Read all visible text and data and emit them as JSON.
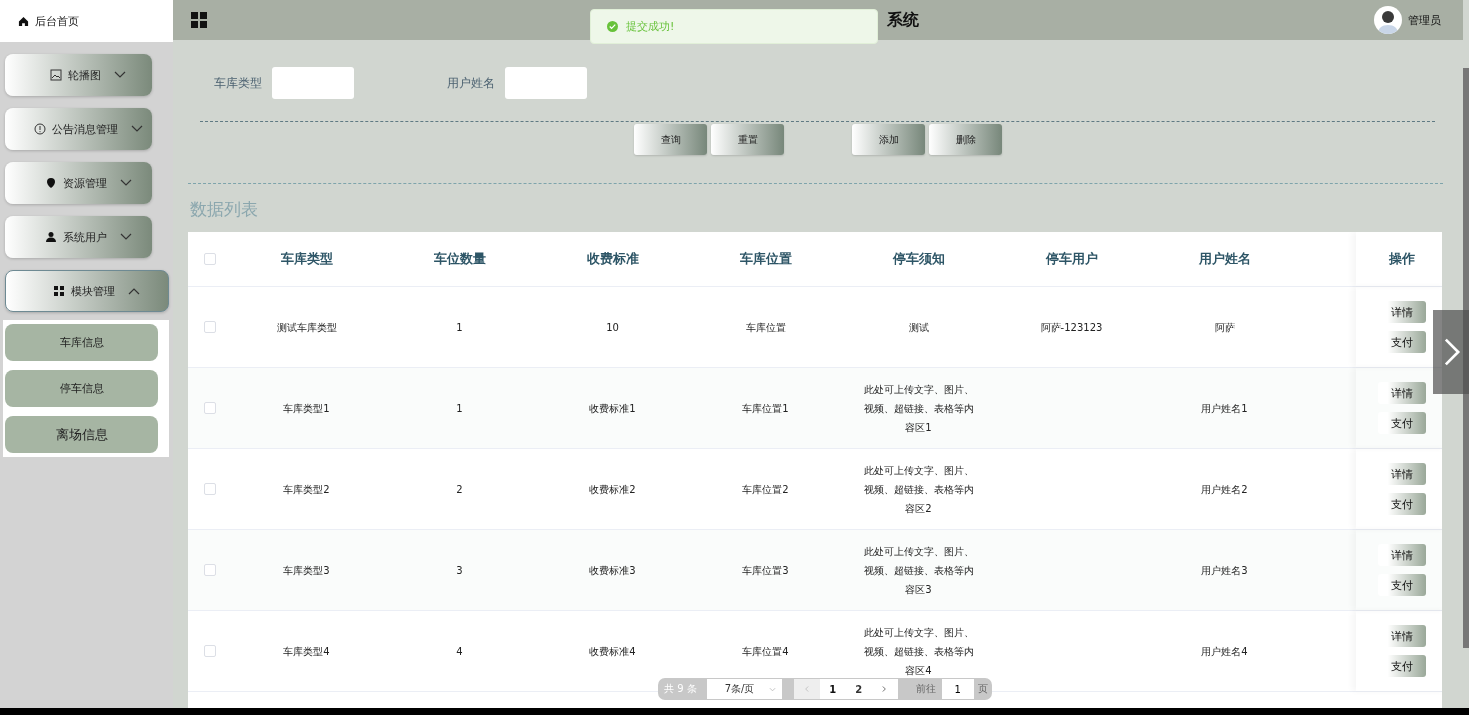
{
  "sidebar": {
    "home": "后台首页",
    "menus": [
      {
        "label": "轮播图",
        "expanded": false
      },
      {
        "label": "公告消息管理",
        "expanded": false
      },
      {
        "label": "资源管理",
        "expanded": false
      },
      {
        "label": "系统用户",
        "expanded": false
      },
      {
        "label": "模块管理",
        "expanded": true,
        "children": [
          "车库信息",
          "停车信息",
          "离场信息"
        ]
      }
    ]
  },
  "header": {
    "title": "系统",
    "user": "管理员"
  },
  "toast": {
    "message": "提交成功!"
  },
  "search": {
    "fields": [
      {
        "label": "车库类型"
      },
      {
        "label": "用户姓名"
      }
    ],
    "buttons": [
      "查询",
      "重置"
    ],
    "actions": [
      "添加",
      "删除"
    ]
  },
  "list_title": "数据列表",
  "table": {
    "all_selected": false,
    "columns": [
      "车库类型",
      "车位数量",
      "收费标准",
      "车库位置",
      "停车须知",
      "停车用户",
      "用户姓名"
    ],
    "action_column": "操作",
    "rows": [
      {
        "selected": false,
        "cells": [
          "测试车库类型",
          "1",
          "10",
          "车库位置",
          "测试",
          "阿萨-123123",
          "阿萨"
        ],
        "buttons": [
          "详情",
          "支付"
        ]
      },
      {
        "selected": false,
        "cells": [
          "车库类型1",
          "1",
          "收费标准1",
          "车库位置1",
          "此处可上传文字、图片、视频、超链接、表格等内容区1",
          "",
          "用户姓名1"
        ],
        "buttons": [
          "详情",
          "支付"
        ]
      },
      {
        "selected": false,
        "cells": [
          "车库类型2",
          "2",
          "收费标准2",
          "车库位置2",
          "此处可上传文字、图片、视频、超链接、表格等内容区2",
          "",
          "用户姓名2"
        ],
        "buttons": [
          "详情",
          "支付"
        ]
      },
      {
        "selected": false,
        "cells": [
          "车库类型3",
          "3",
          "收费标准3",
          "车库位置3",
          "此处可上传文字、图片、视频、超链接、表格等内容区3",
          "",
          "用户姓名3"
        ],
        "buttons": [
          "详情",
          "支付"
        ]
      },
      {
        "selected": false,
        "cells": [
          "车库类型4",
          "4",
          "收费标准4",
          "车库位置4",
          "此处可上传文字、图片、视频、超链接、表格等内容区4",
          "",
          "用户姓名4"
        ],
        "buttons": [
          "详情",
          "支付"
        ]
      }
    ]
  },
  "pagination": {
    "total": "共 9 条",
    "page_size": "7条/页",
    "pages": [
      {
        "label": "1",
        "selected": true
      },
      {
        "label": "2",
        "selected": false
      }
    ],
    "goto_label": "前往",
    "goto_value": "1",
    "page_unit": "页"
  }
}
